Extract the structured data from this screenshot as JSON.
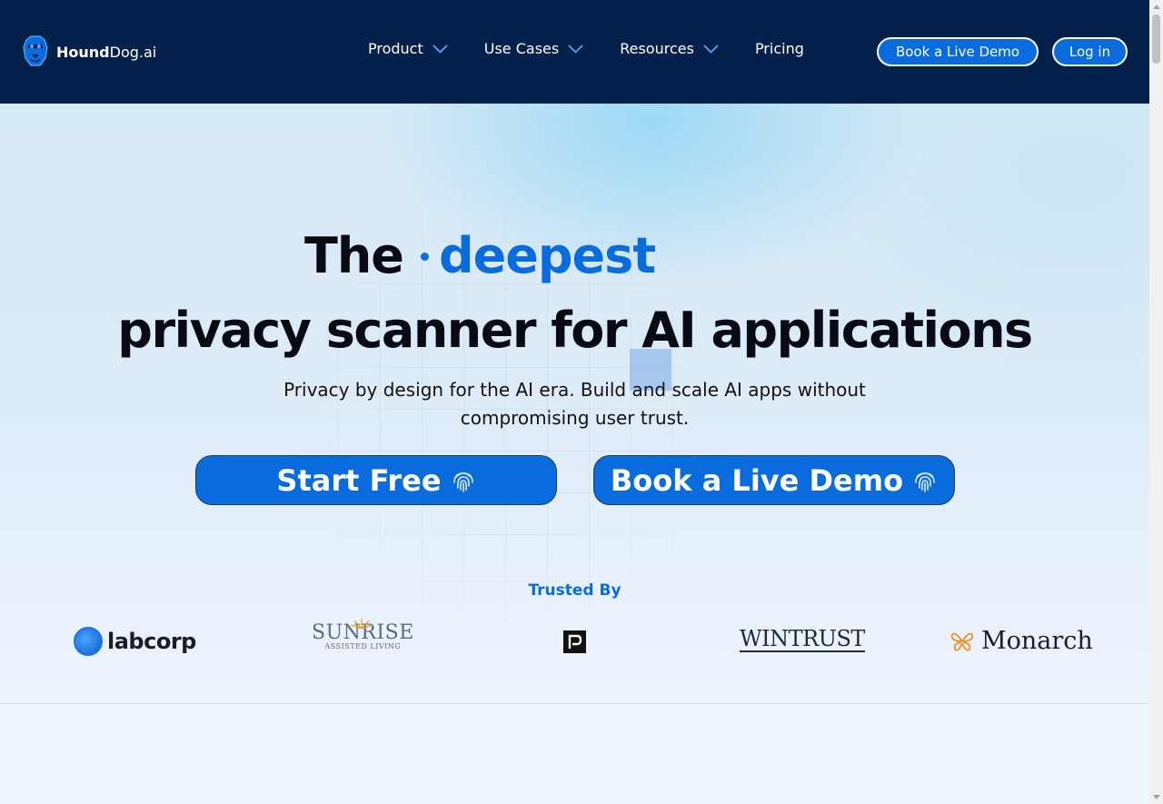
{
  "header": {
    "brand_bold": "Hound",
    "brand_rest": "Dog.ai",
    "nav": [
      {
        "label": "Product",
        "has_dropdown": true
      },
      {
        "label": "Use Cases",
        "has_dropdown": true
      },
      {
        "label": "Resources",
        "has_dropdown": true
      },
      {
        "label": "Pricing",
        "has_dropdown": false
      }
    ],
    "demo_button": "Book a Live Demo",
    "login_button": "Log in"
  },
  "hero": {
    "title_prefix": "The",
    "title_accent": "deepest",
    "title_line2": "privacy scanner for AI applications",
    "subtitle": "Privacy by design for the AI era. Build and scale AI apps without compromising user trust.",
    "cta_primary": "Start Free",
    "cta_secondary": "Book a Live Demo"
  },
  "trusted": {
    "heading": "Trusted By",
    "logos": [
      {
        "name": "labcorp",
        "text": "labcorp"
      },
      {
        "name": "sunrise",
        "text": "SUNRISE",
        "subtext": "ASSISTED LIVING"
      },
      {
        "name": "p-logo",
        "text": ""
      },
      {
        "name": "wintrust",
        "text": "WINTRUST"
      },
      {
        "name": "monarch",
        "text": "Monarch"
      }
    ]
  },
  "colors": {
    "nav_bg": "#03214b",
    "accent": "#0a6cdc",
    "monarch_orange": "#f28c28"
  }
}
